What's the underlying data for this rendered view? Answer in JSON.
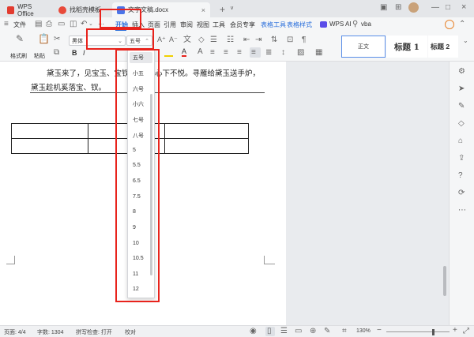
{
  "tabs": {
    "home_label": "WPS Office",
    "template_label": "找稻壳模板",
    "doc_label": "文字文稿.docx",
    "plus": "+",
    "more": "∨"
  },
  "menu": {
    "file": "文件",
    "items": [
      "开始",
      "插入",
      "页面",
      "引用",
      "审阅",
      "视图",
      "工具",
      "会员专享"
    ],
    "table_tools": "表格工具",
    "table_style": "表格样式",
    "ai": "WPS AI",
    "search_icon_label": "vba",
    "more": "···"
  },
  "ribbon": {
    "format_painter": "格式刷",
    "paste": "粘贴",
    "font_name": "黑体",
    "font_size": "五号",
    "bold": "B",
    "italic": "I",
    "styles": [
      "正文",
      "标题 1",
      "标题 2"
    ]
  },
  "document": {
    "line1": "黛玉来了，见宝玉、宝钗",
    "line1_end": "心下不悦。寻雁给黛玉送手炉，",
    "line2": "黛玉趁机奚落宝、钗。"
  },
  "font_sizes": [
    "五号",
    "小五",
    "六号",
    "小六",
    "七号",
    "八号",
    "5",
    "5.5",
    "6.5",
    "7.5",
    "8",
    "9",
    "10",
    "10.5",
    "11",
    "12"
  ],
  "status": {
    "page": "页面: 4/4",
    "words": "字数: 1304",
    "spell": "拼写检查: 打开",
    "proof": "校对",
    "zoom": "130%"
  },
  "colors": {
    "accent_blue": "#2a6fdb",
    "highlight_red": "#e8231c",
    "doc_icon_blue": "#4a74e8",
    "template_icon_red": "#e84a3a"
  }
}
